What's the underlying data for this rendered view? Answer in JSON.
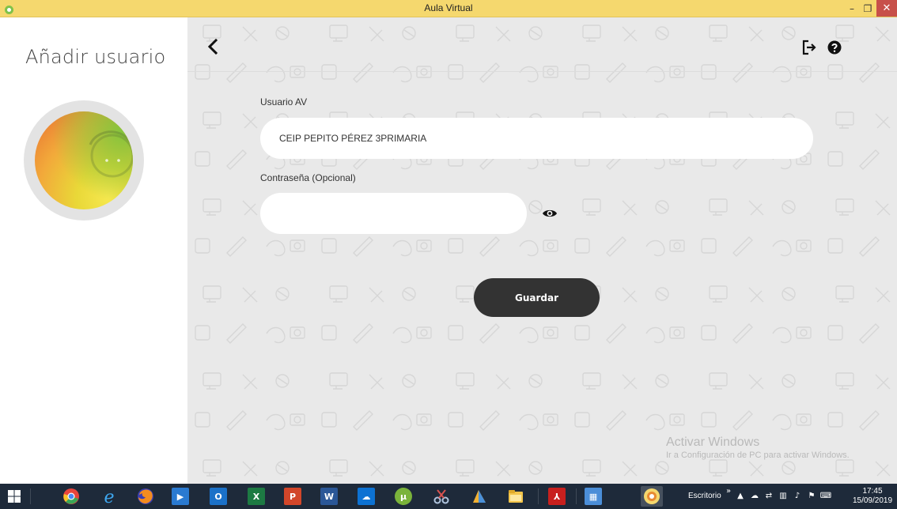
{
  "window": {
    "title": "Aula Virtual",
    "minimize_glyph": "–",
    "restore_glyph": "❐",
    "close_glyph": "✕"
  },
  "left_panel": {
    "title": "Añadir usuario"
  },
  "form": {
    "user_label": "Usuario AV",
    "user_value": "CEIP PEPITO PÉREZ 3PRIMARIA",
    "password_label": "Contraseña (Opcional)",
    "password_value": "",
    "save_label": "Guardar"
  },
  "icons": {
    "back": "chevron-left-icon",
    "logout": "logout-icon",
    "help": "help-circle-icon",
    "show_password": "eye-icon"
  },
  "watermark": {
    "title": "Activar Windows",
    "subtitle": "Ir a Configuración de PC para activar Windows."
  },
  "taskbar": {
    "apps": [
      "start",
      "chrome",
      "internet-explorer",
      "firefox",
      "media-player",
      "outlook",
      "excel",
      "powerpoint",
      "word",
      "onedrive",
      "utorrent",
      "snipping-tool",
      "paint",
      "file-explorer",
      "acrobat-reader",
      "remote-desktop",
      "aula-virtual"
    ],
    "desktop_label": "Escritorio",
    "overflow": "»",
    "clock_time": "17:45",
    "clock_date": "15/09/2019"
  },
  "colors": {
    "titlebar": "#f5d86e",
    "close_button": "#c7504a",
    "primary_button": "#333333",
    "taskbar": "#1e2a3a"
  }
}
